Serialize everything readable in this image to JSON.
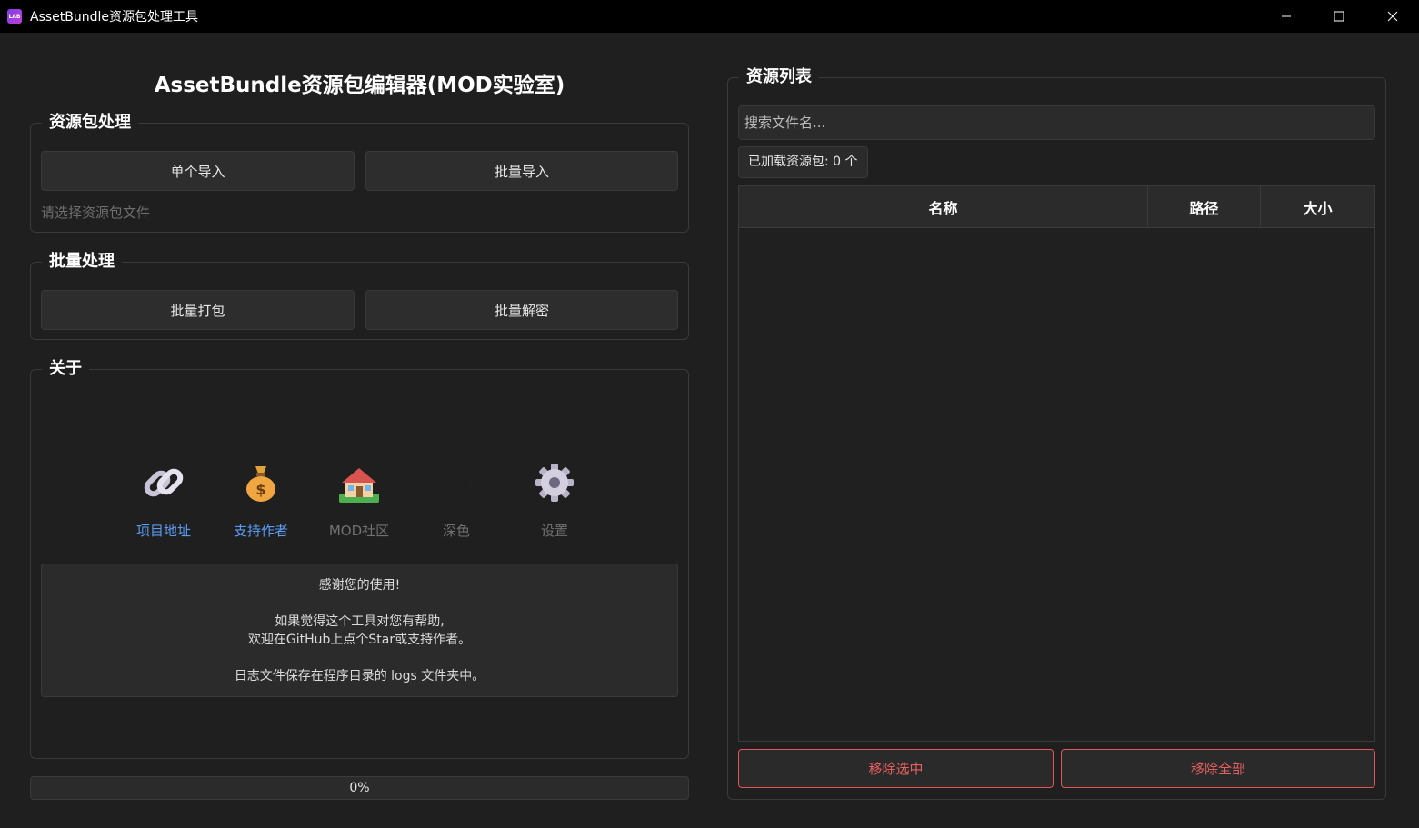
{
  "window": {
    "title": "AssetBundle资源包处理工具",
    "app_icon_text": "LAB",
    "controls": {
      "minimize": "—",
      "maximize": "☐",
      "close": "✕"
    }
  },
  "main_title": "AssetBundle资源包编辑器(MOD实验室)",
  "bundle_group": {
    "title": "资源包处理",
    "single_import": "单个导入",
    "batch_import": "批量导入",
    "hint": "请选择资源包文件"
  },
  "batch_group": {
    "title": "批量处理",
    "batch_pack": "批量打包",
    "batch_decrypt": "批量解密"
  },
  "about_group": {
    "title": "关于",
    "items": [
      {
        "icon": "link-icon",
        "label": "项目地址"
      },
      {
        "icon": "money-bag-icon",
        "label": "支持作者"
      },
      {
        "icon": "house-icon",
        "label": "MOD社区"
      },
      {
        "icon": "moon-icon",
        "label": "深色"
      },
      {
        "icon": "gear-icon",
        "label": "设置"
      }
    ],
    "info": {
      "line1": "感谢您的使用!",
      "line2": "如果觉得这个工具对您有帮助,",
      "line3": "欢迎在GitHub上点个Star或支持作者。",
      "line4": "日志文件保存在程序目录的 logs 文件夹中。"
    }
  },
  "progress": {
    "value": 0,
    "text": "0%"
  },
  "resource_group": {
    "title": "资源列表",
    "search_placeholder": "搜索文件名...",
    "loaded_count": "已加载资源包: 0 个",
    "columns": {
      "name": "名称",
      "path": "路径",
      "size": "大小"
    },
    "rows": [],
    "remove_selected": "移除选中",
    "remove_all": "移除全部"
  },
  "colors": {
    "accent_link": "#5b9bf0",
    "danger": "#e86060",
    "background": "#1f1f1f"
  }
}
